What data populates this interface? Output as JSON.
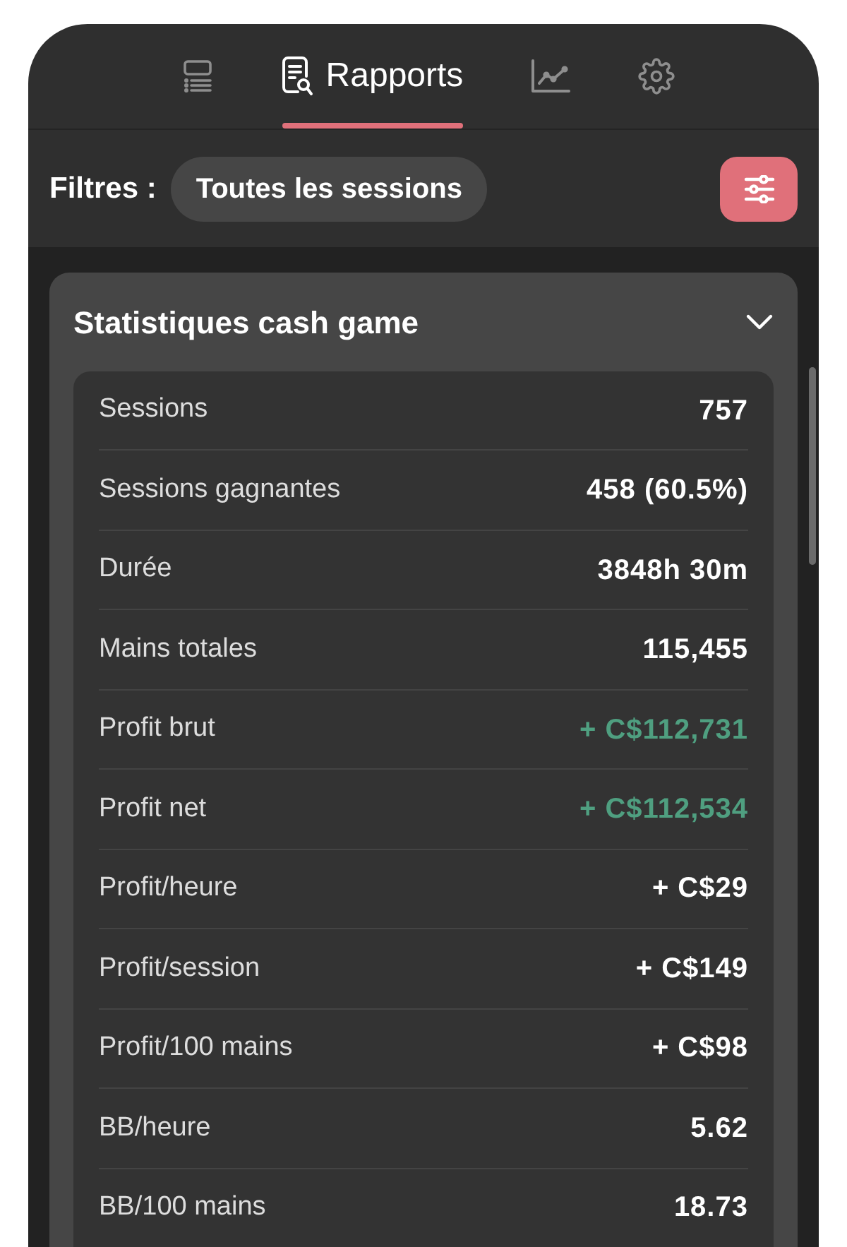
{
  "tabs": [
    {
      "selected": false
    },
    {
      "label": "Rapports",
      "selected": true
    },
    {
      "selected": false
    },
    {
      "selected": false
    }
  ],
  "filters": {
    "label": "Filtres :",
    "chip": "Toutes les sessions"
  },
  "card": {
    "title": "Statistiques cash game",
    "expanded": true,
    "rows": [
      {
        "label": "Sessions",
        "value": "757",
        "highlight": false
      },
      {
        "label": "Sessions gagnantes",
        "value": "458 (60.5%)",
        "highlight": false
      },
      {
        "label": "Durée",
        "value": "3848h 30m",
        "highlight": false
      },
      {
        "label": "Mains totales",
        "value": "115,455",
        "highlight": false
      },
      {
        "label": "Profit brut",
        "value": "+ C$112,731",
        "highlight": true
      },
      {
        "label": "Profit net",
        "value": "+ C$112,534",
        "highlight": true
      },
      {
        "label": "Profit/heure",
        "value": "+ C$29",
        "highlight": false
      },
      {
        "label": "Profit/session",
        "value": "+ C$149",
        "highlight": false
      },
      {
        "label": "Profit/100 mains",
        "value": "+ C$98",
        "highlight": false
      },
      {
        "label": "BB/heure",
        "value": "5.62",
        "highlight": false
      },
      {
        "label": "BB/100 mains",
        "value": "18.73",
        "highlight": false
      }
    ]
  }
}
